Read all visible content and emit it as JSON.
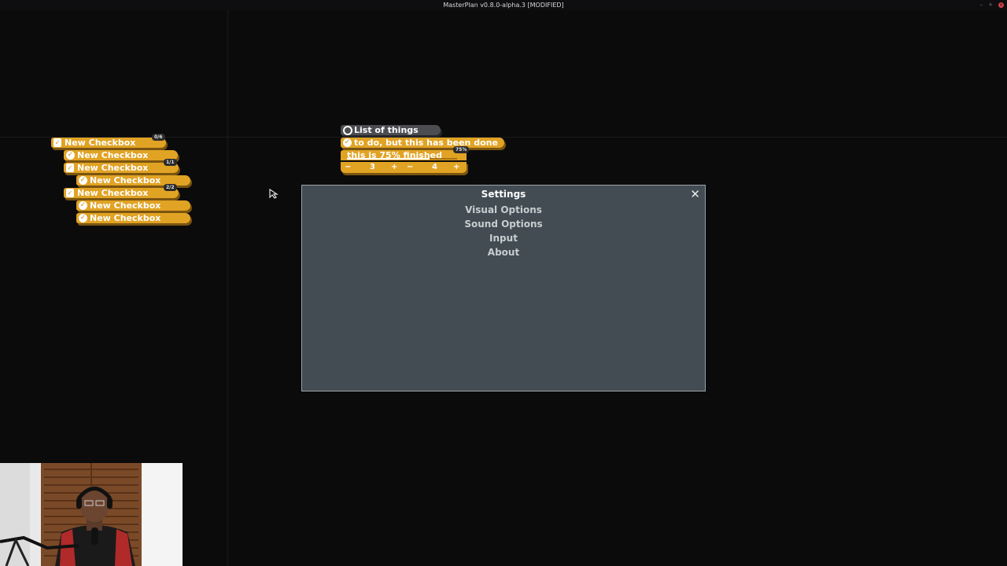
{
  "window": {
    "title": "MasterPlan v0.8.0-alpha.3 [MODIFIED]",
    "minimize_glyph": "–",
    "maximize_glyph": "+",
    "close_glyph": "×"
  },
  "left_group": {
    "cards": [
      {
        "label": "New Checkbox",
        "icon": "doc-check-icon",
        "badge": "0/6"
      },
      {
        "label": "New Checkbox",
        "icon": "checkmark-icon",
        "badge": ""
      },
      {
        "label": "New Checkbox",
        "icon": "doc-check-icon",
        "badge": "1/1"
      },
      {
        "label": "New Checkbox",
        "icon": "checkmark-icon",
        "badge": ""
      },
      {
        "label": "New Checkbox",
        "icon": "doc-check-icon",
        "badge": "2/2"
      },
      {
        "label": "New Checkbox",
        "icon": "checkmark-icon",
        "badge": ""
      },
      {
        "label": "New Checkbox",
        "icon": "checkmark-icon",
        "badge": ""
      }
    ]
  },
  "right_group": {
    "list_title": "List of things",
    "done_item": "to do, but this has been done",
    "progress_item": {
      "label": "this is 75% finished",
      "badge": "75%",
      "progress": 0.75
    },
    "counters": {
      "minus_glyph": "−",
      "plus_glyph": "+",
      "current": "3",
      "max": "4"
    }
  },
  "settings": {
    "title": "Settings",
    "close_glyph": "✕",
    "menu": [
      "Visual Options",
      "Sound Options",
      "Input",
      "About"
    ]
  },
  "colors": {
    "card_orange": "#e1a324",
    "card_gray": "#4b4d51",
    "panel_bg": "#424c52",
    "canvas_bg": "#0b0b0c"
  }
}
